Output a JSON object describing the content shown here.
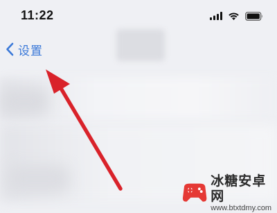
{
  "status_bar": {
    "time": "11:22",
    "icons": [
      "signal-icon",
      "wifi-icon",
      "battery-icon"
    ]
  },
  "nav": {
    "back_icon": "chevron-left-icon",
    "back_label": "设置"
  },
  "annotation": {
    "type": "arrow",
    "color": "#d9222a",
    "points_to": "back-button"
  },
  "watermark": {
    "title": "冰糖安卓网",
    "url": "www.btxtdmy.com"
  },
  "colors": {
    "background": "#eff0f4",
    "link": "#3a78d8",
    "arrow": "#d9222a",
    "logo": "#e53935"
  }
}
